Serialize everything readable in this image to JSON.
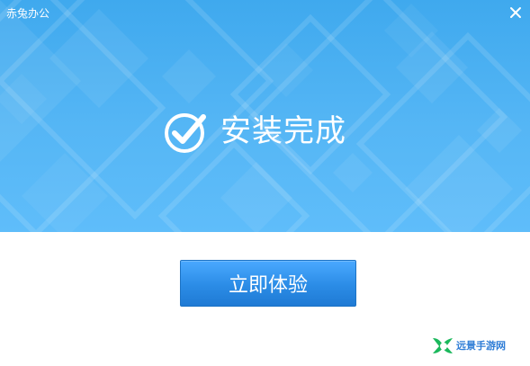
{
  "window": {
    "title": "赤兔办公",
    "close_icon": "close-icon"
  },
  "banner": {
    "status_text": "安装完成",
    "check_icon": "check-circle-icon"
  },
  "actions": {
    "primary_button": "立即体验"
  },
  "watermark": {
    "text": "远景手游网"
  },
  "colors": {
    "banner_top": "#3fa9ee",
    "banner_bottom": "#5fbdfa",
    "button_top": "#4aa9ff",
    "button_bottom": "#1f7ad4",
    "watermark_green": "#1bb85c",
    "watermark_blue": "#2f7dd6"
  }
}
